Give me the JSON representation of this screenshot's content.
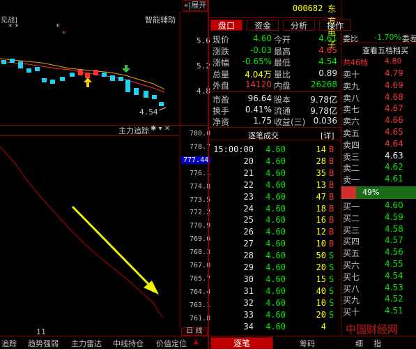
{
  "chart": {
    "title_left": "见战]",
    "title_right": "智能辅助",
    "stars": "* *",
    "star2": "*",
    "star3": "*",
    "price_ticks": [
      "5.6",
      "5.2",
      "4.8"
    ],
    "price_marker": "4.54",
    "collapse_label": "«|展开"
  },
  "indicator": {
    "title": "主力追踪",
    "icons": "✱ ▾ ✕",
    "ticks": [
      "780.0",
      "778.7",
      "777.44",
      "776.1",
      "774.8",
      "773.5",
      "772.2",
      "770.9",
      "769.6",
      "768.3",
      "767.0",
      "765.7",
      "764.4",
      "763.1",
      "761.8"
    ],
    "highlight_tick": "777.44",
    "time_label": "11",
    "day_line_label": "日 线"
  },
  "bottom_tabs": [
    "追踪",
    "趋势强弱",
    "主力雷达",
    "中线持仓",
    "价值定位"
  ],
  "bottom_arrow": "▲",
  "stock": {
    "code": "000682",
    "name": "东方电子",
    "colors": {
      "accent": "#c00000",
      "up": "#ff3232",
      "down": "#00e600"
    }
  },
  "tabs": [
    "盘口",
    "资金",
    "分析",
    "操作"
  ],
  "quote": [
    {
      "l1": "现价",
      "v1": "4.60",
      "c1": "green",
      "l2": "今开",
      "v2": "4.61",
      "c2": "green"
    },
    {
      "l1": "涨跌",
      "v1": "-0.03",
      "c1": "green",
      "l2": "最高",
      "v2": "4.65",
      "c2": "red"
    },
    {
      "l1": "涨幅",
      "v1": "-0.65%",
      "c1": "green",
      "l2": "最低",
      "v2": "4.54",
      "c2": "green"
    },
    {
      "l1": "总量",
      "v1": "4.04万",
      "c1": "yellow",
      "l2": "量比",
      "v2": "0.89",
      "c2": "white"
    },
    {
      "l1": "外盘",
      "v1": "14120",
      "c1": "red",
      "l2": "内盘",
      "v2": "26268",
      "c2": "green"
    }
  ],
  "quote2": [
    {
      "l1": "市盈",
      "v1": "96.64",
      "l2": "股本",
      "v2": "9.78亿"
    },
    {
      "l1": "换手",
      "v1": "0.41%",
      "l2": "流通",
      "v2": "9.78亿"
    },
    {
      "l1": "净资",
      "v1": "1.75",
      "l2": "收益(三)",
      "v2": "0.036"
    }
  ],
  "trades_title": "逐笔成交",
  "trades_detail": "[详]",
  "trades": [
    {
      "t": "15:00:00",
      "p": "4.60",
      "v": "14",
      "d": "B"
    },
    {
      "t": "20",
      "p": "4.60",
      "v": "28",
      "d": "B"
    },
    {
      "t": "21",
      "p": "4.60",
      "v": "35",
      "d": "B"
    },
    {
      "t": "22",
      "p": "4.60",
      "v": "13",
      "d": "B"
    },
    {
      "t": "23",
      "p": "4.60",
      "v": "47",
      "d": "B"
    },
    {
      "t": "24",
      "p": "4.60",
      "v": "18",
      "d": "B"
    },
    {
      "t": "25",
      "p": "4.60",
      "v": "16",
      "d": "B"
    },
    {
      "t": "26",
      "p": "4.60",
      "v": "12",
      "d": "B"
    },
    {
      "t": "27",
      "p": "4.60",
      "v": "10",
      "d": "B"
    },
    {
      "t": "28",
      "p": "4.60",
      "v": "50",
      "d": "S"
    },
    {
      "t": "29",
      "p": "4.60",
      "v": "20",
      "d": "S"
    },
    {
      "t": "30",
      "p": "4.60",
      "v": "15",
      "d": "S"
    },
    {
      "t": "31",
      "p": "4.60",
      "v": "40",
      "d": "S"
    },
    {
      "t": "32",
      "p": "4.60",
      "v": "10",
      "d": "S"
    },
    {
      "t": "33",
      "p": "4.60",
      "v": "20",
      "d": "S"
    },
    {
      "t": "34",
      "p": "4.60",
      "v": "4",
      "d": ""
    }
  ],
  "order": {
    "weibi_label": "委比",
    "weibi_value": "-1.70%",
    "weicha_label": "委差",
    "view_all": "查看五档档买",
    "total_levels": "共46档",
    "sells": [
      {
        "l": "卖十",
        "p": "4.79"
      },
      {
        "l": "卖九",
        "p": "4.69"
      },
      {
        "l": "卖八",
        "p": "4.68"
      },
      {
        "l": "卖七",
        "p": "4.67"
      },
      {
        "l": "卖六",
        "p": "4.66"
      },
      {
        "l": "卖五",
        "p": "4.65"
      },
      {
        "l": "卖四",
        "p": "4.64"
      },
      {
        "l": "卖三",
        "p": "4.63"
      },
      {
        "l": "卖二",
        "p": "4.62"
      },
      {
        "l": "卖一",
        "p": "4.61"
      }
    ],
    "top_price": "4.80",
    "ratio": "49%",
    "ratio_value": 49,
    "buys": [
      {
        "l": "买一",
        "p": "4.60"
      },
      {
        "l": "买二",
        "p": "4.59"
      },
      {
        "l": "买三",
        "p": "4.58"
      },
      {
        "l": "买四",
        "p": "4.57"
      },
      {
        "l": "买五",
        "p": "4.56"
      },
      {
        "l": "买六",
        "p": "4.55"
      },
      {
        "l": "买七",
        "p": "4.54"
      },
      {
        "l": "买八",
        "p": "4.53"
      },
      {
        "l": "买九",
        "p": "4.52"
      },
      {
        "l": "买十",
        "p": "4.51"
      }
    ]
  },
  "bottom_right_tabs": [
    "逐笔",
    "筹码",
    "细",
    "指"
  ],
  "watermark": "中国财经网"
}
